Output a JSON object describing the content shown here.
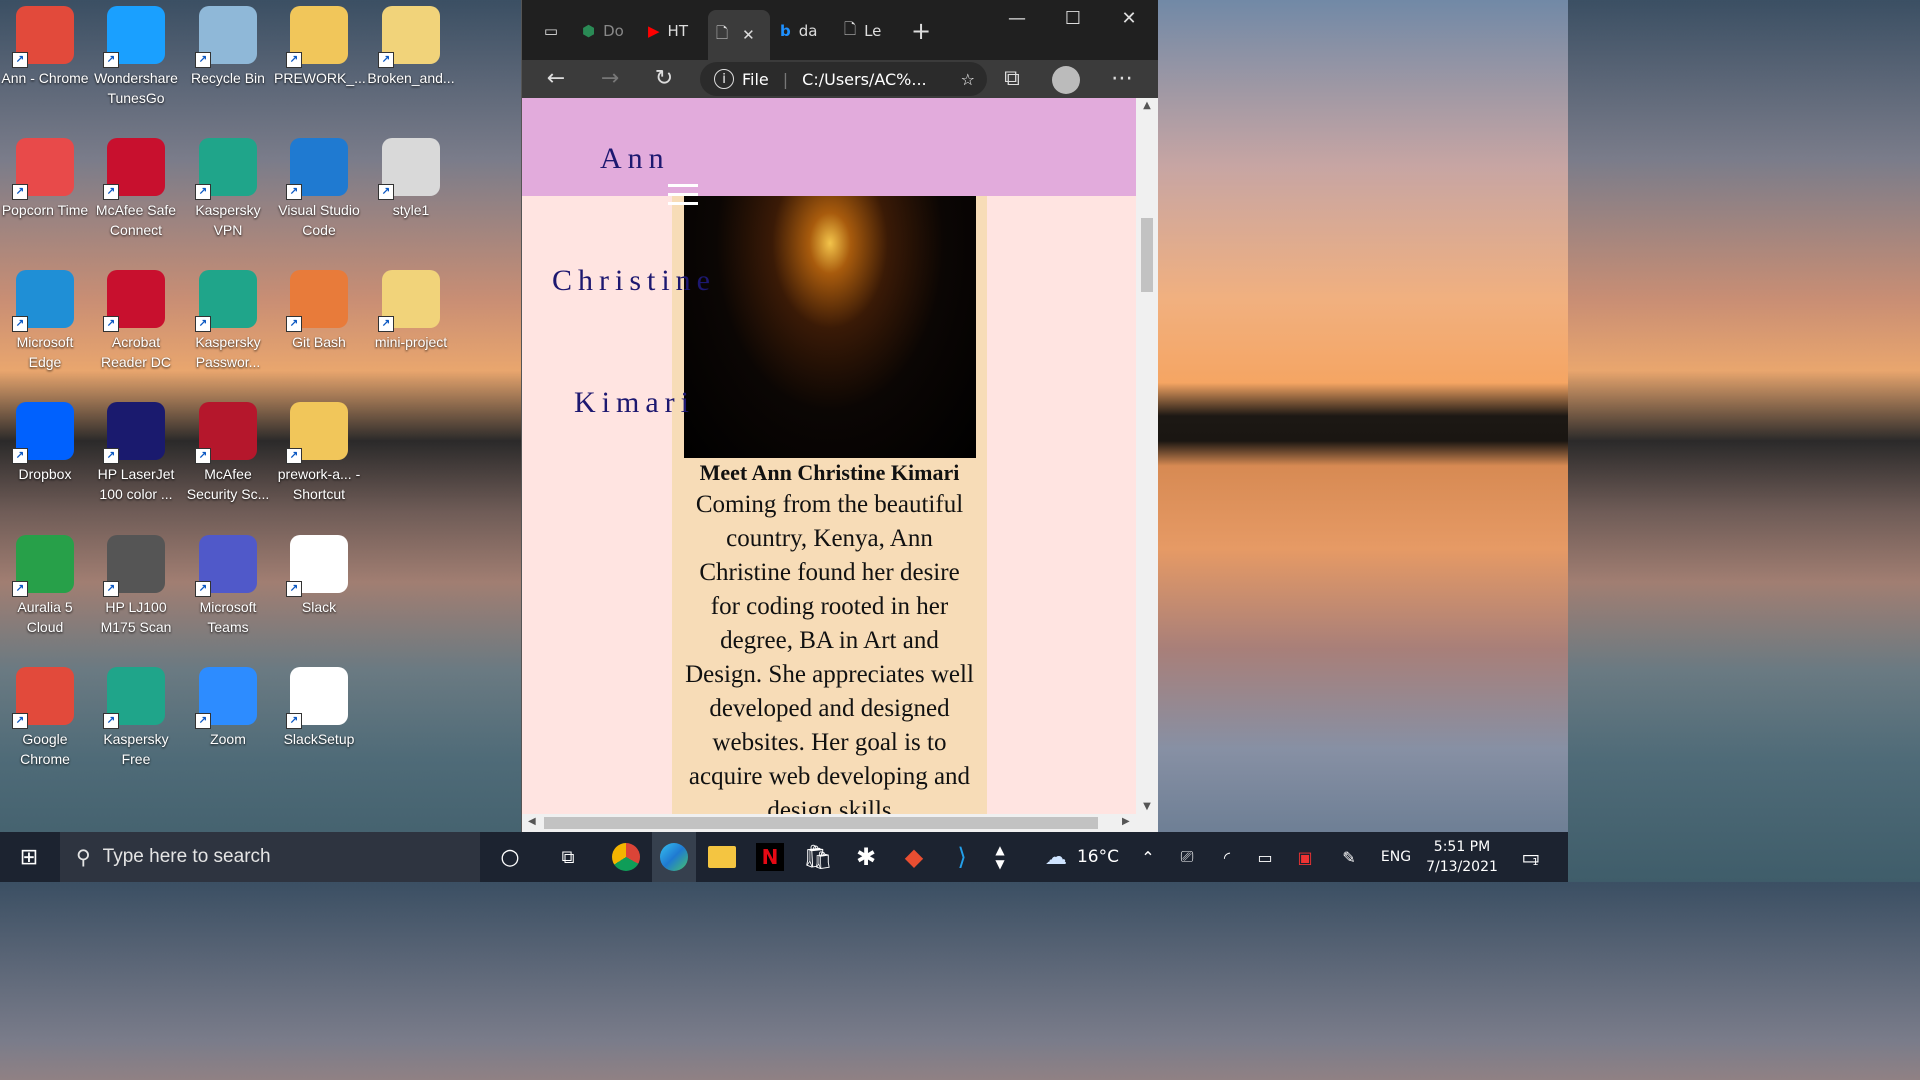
{
  "desktop": {
    "icons": [
      {
        "label": "Ann - Chrome",
        "icon": "chrome-icon"
      },
      {
        "label": "Wondershare TunesGo",
        "icon": "tunesgo-icon"
      },
      {
        "label": "Recycle Bin",
        "icon": "recycle-bin-icon"
      },
      {
        "label": "PREWORK_...",
        "icon": "folder-icon"
      },
      {
        "label": "Broken_and...",
        "icon": "zip-folder-icon"
      },
      {
        "label": "Popcorn Time",
        "icon": "popcorn-icon"
      },
      {
        "label": "McAfee Safe Connect",
        "icon": "mcafee-icon"
      },
      {
        "label": "Kaspersky VPN",
        "icon": "kaspersky-vpn-icon"
      },
      {
        "label": "Visual Studio Code",
        "icon": "vscode-icon"
      },
      {
        "label": "style1",
        "icon": "css-file-icon"
      },
      {
        "label": "Microsoft Edge",
        "icon": "edge-icon"
      },
      {
        "label": "Acrobat Reader DC",
        "icon": "acrobat-icon"
      },
      {
        "label": "Kaspersky Passwor...",
        "icon": "kaspersky-password-icon"
      },
      {
        "label": "Git Bash",
        "icon": "git-bash-icon"
      },
      {
        "label": "mini-project",
        "icon": "folder-icon"
      },
      {
        "label": "Dropbox",
        "icon": "dropbox-icon"
      },
      {
        "label": "HP LaserJet 100 color ...",
        "icon": "hp-printer-icon"
      },
      {
        "label": "McAfee Security Sc...",
        "icon": "mcafee-scan-icon"
      },
      {
        "label": "prework-a... - Shortcut",
        "icon": "folder-shortcut-icon"
      },
      {
        "label": "Auralia 5 Cloud",
        "icon": "auralia-icon"
      },
      {
        "label": "HP LJ100 M175 Scan",
        "icon": "scanner-icon"
      },
      {
        "label": "Microsoft Teams",
        "icon": "teams-icon"
      },
      {
        "label": "Slack",
        "icon": "slack-icon"
      },
      {
        "label": "Google Chrome",
        "icon": "chrome-icon"
      },
      {
        "label": "Kaspersky Free",
        "icon": "kaspersky-free-icon"
      },
      {
        "label": "Zoom",
        "icon": "zoom-icon"
      },
      {
        "label": "SlackSetup",
        "icon": "slack-icon"
      }
    ]
  },
  "browser": {
    "tabs": [
      {
        "label": "Do"
      },
      {
        "label": "HT"
      },
      {
        "label": ""
      },
      {
        "label": "da"
      },
      {
        "label": "Le"
      }
    ],
    "address_prefix": "File",
    "address": "C:/Users/AC%...",
    "window_controls": {
      "minimize": "—",
      "maximize": "☐",
      "close": "✕"
    }
  },
  "page": {
    "brand_first": "Ann",
    "brand_middle": "Christine",
    "brand_last": "Kimari",
    "card_heading": "Meet Ann Christine Kimari",
    "card_body": "Coming from the beautiful country, Kenya, Ann Christine found her desire for coding rooted in her degree, BA in Art and Design. She appreciates well developed and designed websites. Her goal is to acquire web developing and design skills"
  },
  "taskbar": {
    "search_placeholder": "Type here to search",
    "weather": "16°C",
    "language": "ENG",
    "time": "5:51 PM",
    "date": "7/13/2021",
    "notification_count": "1"
  },
  "colors": {
    "header_bg": "#e2abdc",
    "page_bg": "#ffe4e1",
    "card_bg": "#f7dcb7",
    "brand_text": "#1d1870",
    "browser_chrome": "#202020"
  }
}
